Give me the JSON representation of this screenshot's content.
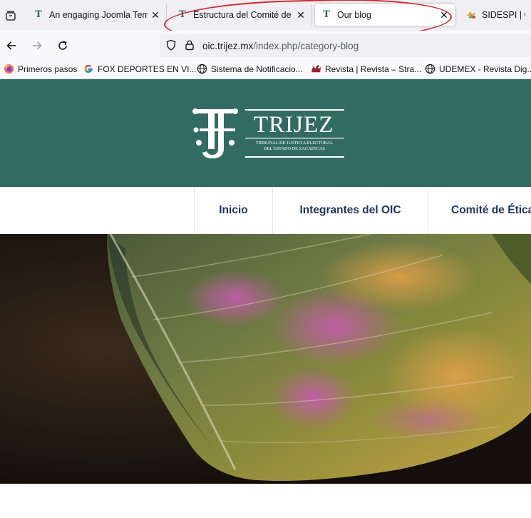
{
  "browser": {
    "tabs": [
      {
        "title": "An engaging Joomla Templ",
        "favicon": "trijez-icon",
        "active": false
      },
      {
        "title": "Estructura del Comité de Ét",
        "favicon": "trijez-icon",
        "active": false
      },
      {
        "title": "Our blog",
        "favicon": "trijez-icon",
        "active": true
      },
      {
        "title": "SIDESPI | Gob",
        "favicon": "sidespi-icon",
        "active": false
      }
    ],
    "close_glyph": "✕",
    "url": {
      "domain": "oic.trijez.mx",
      "path": "/index.php/category-blog"
    },
    "bookmarks": [
      {
        "label": "Primeros pasos",
        "icon": "firefox-icon"
      },
      {
        "label": "FOX DEPORTES EN VI...",
        "icon": "google-icon"
      },
      {
        "label": "Sistema de Notificacio...",
        "icon": "globe-icon"
      },
      {
        "label": "Revista | Revista – Stra...",
        "icon": "revista-icon"
      },
      {
        "label": "UDEMEX - Revista Dig...",
        "icon": "globe-icon"
      }
    ]
  },
  "site": {
    "brand": "TRIJEZ",
    "brand_sub_line1": "TRIBUNAL DE JUSTICIA ELECTORAL",
    "brand_sub_line2": "DEL ESTADO DE ZACATECAS",
    "menu": [
      "Inicio",
      "Integrantes del OIC",
      "Comité de Ética"
    ],
    "colors": {
      "header_bg": "#326b61",
      "menu_text": "#1f3457",
      "annotation": "#d22a2a"
    }
  }
}
